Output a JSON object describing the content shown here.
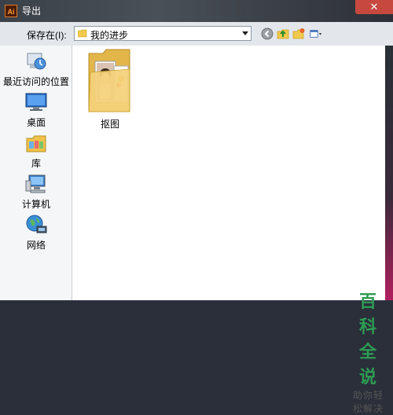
{
  "window": {
    "title": "导出",
    "app_icon_text": "Ai",
    "close_glyph": "✕"
  },
  "toolbar": {
    "save_in_label": "保存在(I):",
    "location_value": "我的进步"
  },
  "places": [
    {
      "label": "最近访问的位置",
      "icon": "recent-places-icon"
    },
    {
      "label": "桌面",
      "icon": "desktop-icon"
    },
    {
      "label": "库",
      "icon": "libraries-icon"
    },
    {
      "label": "计算机",
      "icon": "computer-icon"
    },
    {
      "label": "网络",
      "icon": "network-icon"
    }
  ],
  "files": [
    {
      "name": "抠图",
      "icon": "folder-with-photos-icon"
    }
  ],
  "watermark": {
    "title": "百科全说",
    "subtitle": "助你轻松解决"
  },
  "colors": {
    "title_bar": "#3b4148",
    "close_button": "#c7483f",
    "watermark_green": "#2e9b53"
  }
}
